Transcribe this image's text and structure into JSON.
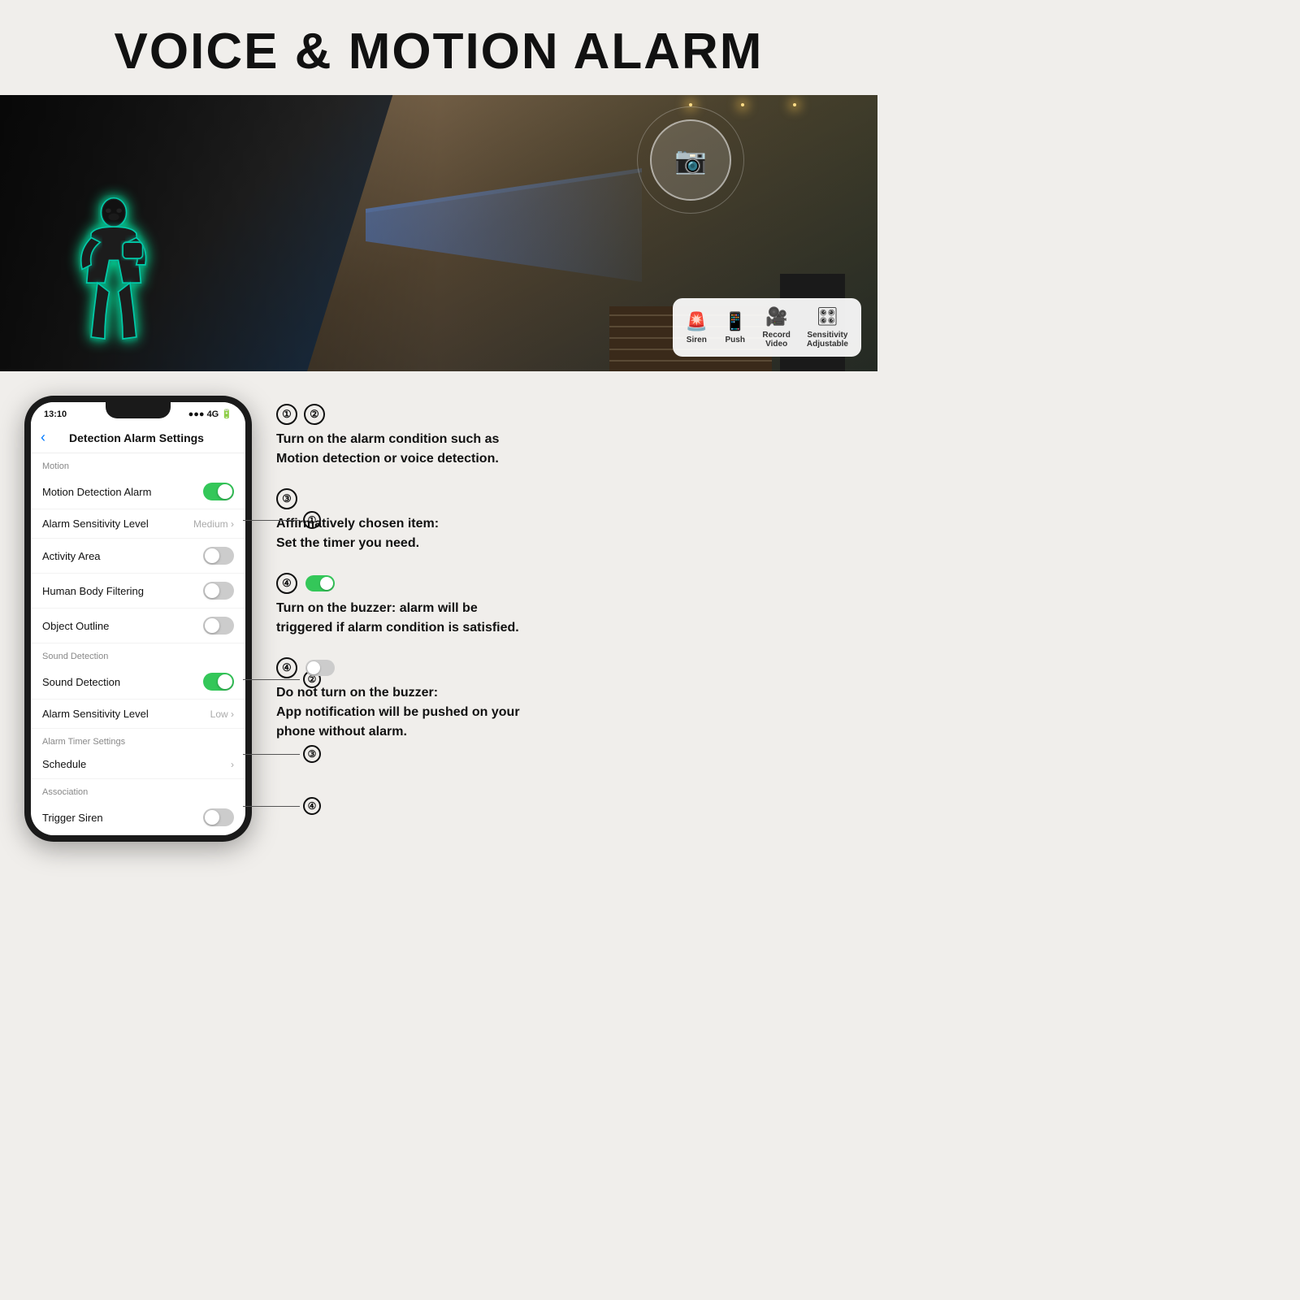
{
  "page": {
    "title": "VOICE & MOTION ALARM"
  },
  "hero": {
    "steps": [
      {
        "icon": "🚨",
        "label": "Siren",
        "color": "red"
      },
      {
        "icon": "📱",
        "label": "Push",
        "color": "normal"
      },
      {
        "icon": "🎥",
        "label": "Record\nVideo",
        "color": "normal"
      },
      {
        "icon": "🎛",
        "label": "Sensitivity\nAdjustable",
        "color": "normal"
      }
    ]
  },
  "phone": {
    "status_time": "13:10",
    "status_signal": "●●●● 4G",
    "header_title": "Detection Alarm Settings",
    "back_label": "‹",
    "sections": [
      {
        "label": "Motion",
        "rows": [
          {
            "label": "Motion Detection Alarm",
            "type": "toggle",
            "value": "on"
          },
          {
            "label": "Alarm Sensitivity Level",
            "type": "value",
            "value": "Medium ›"
          },
          {
            "label": "Activity Area",
            "type": "toggle",
            "value": "off"
          },
          {
            "label": "Human Body Filtering",
            "type": "toggle",
            "value": "off"
          },
          {
            "label": "Object Outline",
            "type": "toggle",
            "value": "off"
          }
        ]
      },
      {
        "label": "Sound Detection",
        "rows": [
          {
            "label": "Sound Detection",
            "type": "toggle",
            "value": "on"
          },
          {
            "label": "Alarm Sensitivity Level",
            "type": "value",
            "value": "Low ›"
          }
        ]
      },
      {
        "label": "Alarm Timer Settings",
        "rows": [
          {
            "label": "Schedule",
            "type": "arrow",
            "value": "›"
          }
        ]
      },
      {
        "label": "Association",
        "rows": [
          {
            "label": "Trigger Siren",
            "type": "toggle",
            "value": "off"
          }
        ]
      }
    ]
  },
  "callouts": [
    {
      "number": "①",
      "row_index": 0,
      "section": 0
    },
    {
      "number": "②",
      "row_index": 0,
      "section": 1
    },
    {
      "number": "③",
      "row_index": 0,
      "section": 2
    },
    {
      "number": "④",
      "row_index": 0,
      "section": 3
    }
  ],
  "explanations": [
    {
      "numbers": "① ②",
      "text": "Turn on the alarm condition such as\nMotion detection or voice detection."
    },
    {
      "numbers": "③",
      "text": "Affirmatively chosen item:\nSet the timer you need."
    },
    {
      "numbers": "④",
      "toggle_state": "on",
      "text": "Turn on the buzzer: alarm will be\ntriggered if alarm condition is satisfied."
    },
    {
      "numbers": "④",
      "toggle_state": "off",
      "text": "Do not turn on the buzzer:\nApp notification will be pushed on your\nphone without alarm."
    }
  ]
}
